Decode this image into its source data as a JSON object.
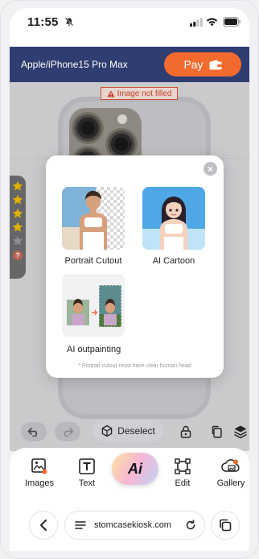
{
  "status": {
    "time": "11:55"
  },
  "header": {
    "device": "Apple/iPhone15 Pro Max",
    "pay_label": "Pay"
  },
  "canvas": {
    "warning": "Image not filled"
  },
  "modal": {
    "options": [
      {
        "label": "Portrait Cutout"
      },
      {
        "label": "AI Cartoon"
      },
      {
        "label": "AI outpainting"
      }
    ],
    "note": "* Portrait cutout must have clear human head"
  },
  "actions": {
    "deselect_label": "Deselect"
  },
  "tools": {
    "items": [
      {
        "label": "Images"
      },
      {
        "label": "Text"
      },
      {
        "label": "Edit"
      },
      {
        "label": "Gallery"
      }
    ],
    "ai_label": "Ai"
  },
  "browser": {
    "url": "stomcasekiosk.com"
  },
  "colors": {
    "header_bg": "#2f3d70",
    "accent": "#f36a2f",
    "warning": "#d3492b",
    "star": "#f2c200"
  }
}
